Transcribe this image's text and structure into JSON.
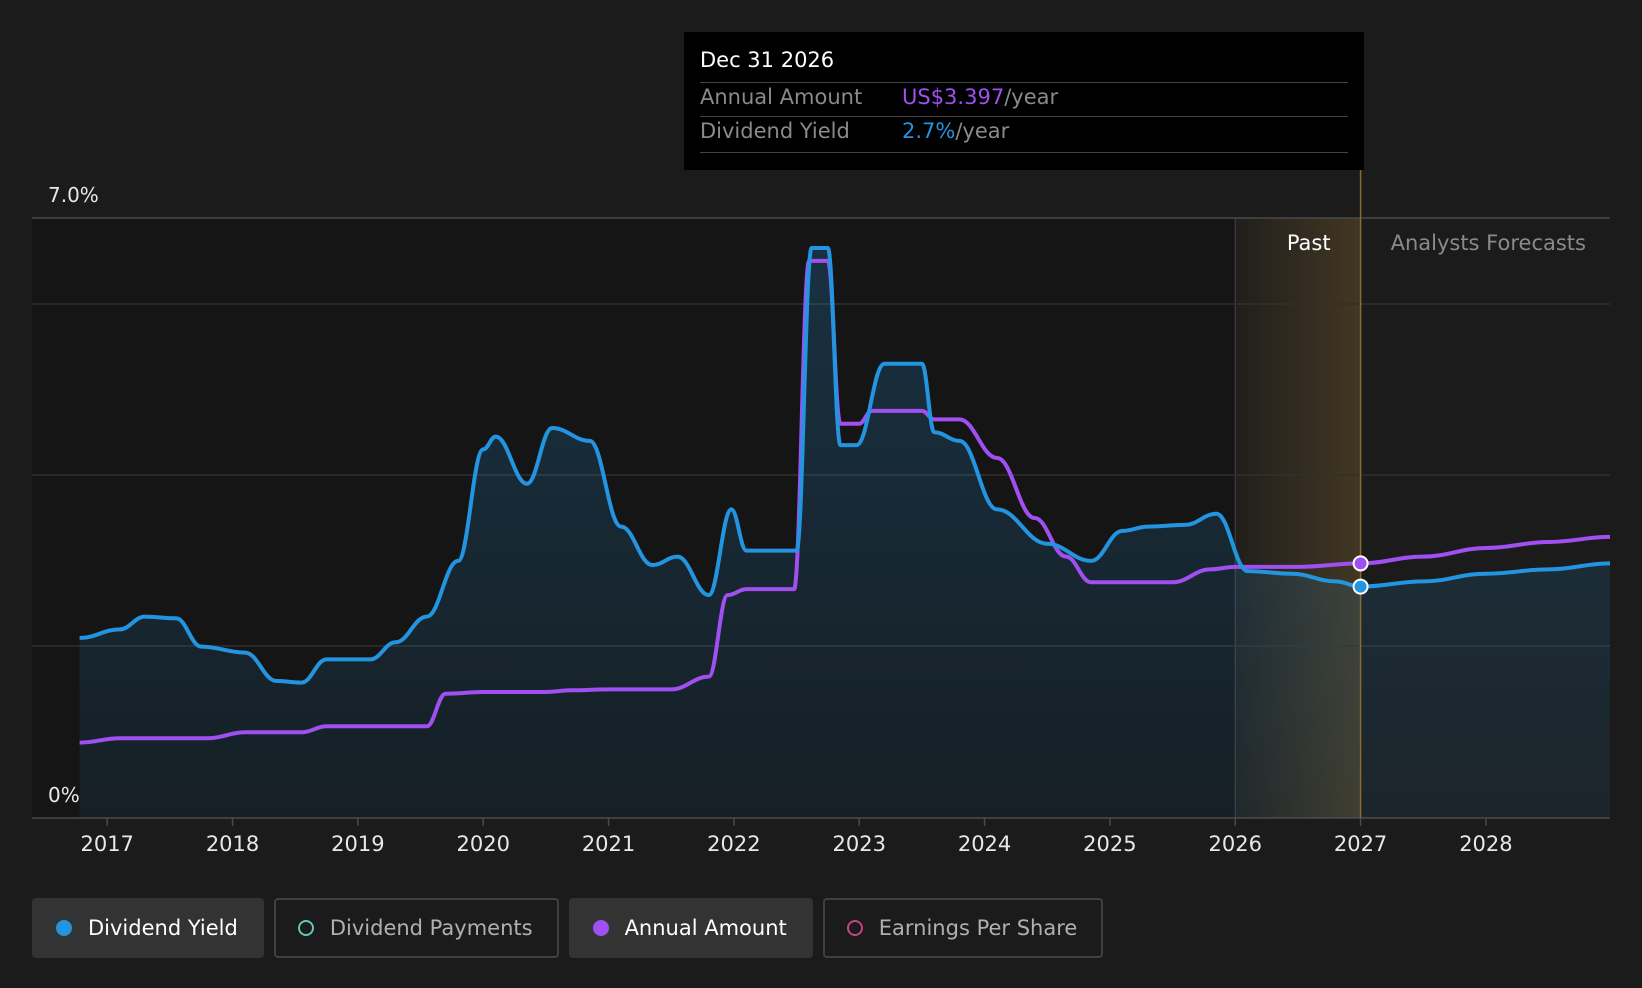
{
  "colors": {
    "background": "#1b1b1b",
    "plot_past": "#151515",
    "dividend_yield": "#2394df",
    "annual_amount": "#a04ff0",
    "dividend_payments": "#5fc9b9",
    "earnings_per_share": "#c9417f",
    "forecast_band": "#8a6a30",
    "grid": "#333333"
  },
  "tooltip": {
    "date": "Dec 31 2026",
    "rows": [
      {
        "label": "Annual Amount",
        "value": "US$3.397",
        "unit": "/year",
        "color": "#a04ff0"
      },
      {
        "label": "Dividend Yield",
        "value": "2.7%",
        "unit": "/year",
        "color": "#2394df"
      }
    ]
  },
  "legend": [
    {
      "label": "Dividend Yield",
      "color": "#2394df",
      "state": "active",
      "icon": "filled-dot-icon"
    },
    {
      "label": "Dividend Payments",
      "color": "#5fc9b9",
      "state": "inactive",
      "icon": "hollow-dot-icon"
    },
    {
      "label": "Annual Amount",
      "color": "#a04ff0",
      "state": "active",
      "icon": "filled-dot-icon"
    },
    {
      "label": "Earnings Per Share",
      "color": "#c9417f",
      "state": "inactive",
      "icon": "hollow-dot-icon"
    }
  ],
  "chart_data": {
    "type": "line",
    "title": "",
    "ylim": [
      0,
      7.0
    ],
    "y_tick_labels": [
      "0%",
      "7.0%"
    ],
    "x_tick_labels": [
      "2017",
      "2018",
      "2019",
      "2020",
      "2021",
      "2022",
      "2023",
      "2024",
      "2025",
      "2026",
      "2027",
      "2028"
    ],
    "x_range": [
      2016.4,
      2028.99
    ],
    "grid": true,
    "legend_placement": "bottom",
    "region_labels": {
      "past": "Past",
      "forecast": "Analysts Forecasts"
    },
    "forecast_start": 2026.0,
    "highlight_x": 2027.0,
    "series": [
      {
        "name": "Dividend Yield",
        "x": [
          2016.78,
          2017.1,
          2017.3,
          2017.55,
          2017.75,
          2018.1,
          2018.35,
          2018.55,
          2018.75,
          2019.1,
          2019.3,
          2019.55,
          2019.8,
          2020.0,
          2020.1,
          2020.35,
          2020.55,
          2020.85,
          2021.1,
          2021.35,
          2021.55,
          2021.8,
          2021.98,
          2022.1,
          2022.5,
          2022.62,
          2022.75,
          2022.85,
          2022.98,
          2023.2,
          2023.5,
          2023.6,
          2023.8,
          2024.1,
          2024.5,
          2024.85,
          2025.1,
          2025.3,
          2025.6,
          2025.85,
          2026.1,
          2026.45,
          2026.8,
          2027.0,
          2027.5,
          2028.0,
          2028.5,
          2028.99
        ],
        "values": [
          2.1,
          2.2,
          2.35,
          2.33,
          2.0,
          1.93,
          1.6,
          1.58,
          1.85,
          1.85,
          2.05,
          2.35,
          3.0,
          4.3,
          4.45,
          3.9,
          4.55,
          4.4,
          3.4,
          2.95,
          3.05,
          2.6,
          3.6,
          3.12,
          3.12,
          6.65,
          6.65,
          4.35,
          4.35,
          5.3,
          5.3,
          4.5,
          4.4,
          3.6,
          3.2,
          3.0,
          3.35,
          3.4,
          3.42,
          3.55,
          2.88,
          2.85,
          2.76,
          2.7,
          2.76,
          2.85,
          2.9,
          2.97
        ]
      },
      {
        "name": "Annual Amount",
        "x": [
          2016.78,
          2017.1,
          2017.5,
          2017.8,
          2018.1,
          2018.55,
          2018.75,
          2019.1,
          2019.55,
          2019.7,
          2020.0,
          2020.5,
          2020.7,
          2021.0,
          2021.5,
          2021.8,
          2021.95,
          2022.1,
          2022.48,
          2022.6,
          2022.75,
          2022.85,
          2023.0,
          2023.1,
          2023.5,
          2023.6,
          2023.8,
          2024.1,
          2024.4,
          2024.65,
          2024.85,
          2025.1,
          2025.5,
          2025.8,
          2026.0,
          2026.5,
          2027.0,
          2027.5,
          2028.0,
          2028.5,
          2028.99
        ],
        "values": [
          0.88,
          0.93,
          0.93,
          0.93,
          1.0,
          1.0,
          1.07,
          1.07,
          1.07,
          1.45,
          1.47,
          1.47,
          1.49,
          1.5,
          1.5,
          1.65,
          2.6,
          2.67,
          2.67,
          6.5,
          6.5,
          4.6,
          4.6,
          4.75,
          4.75,
          4.65,
          4.65,
          4.2,
          3.5,
          3.05,
          2.75,
          2.75,
          2.75,
          2.9,
          2.93,
          2.93,
          2.97,
          3.05,
          3.15,
          3.22,
          3.28
        ]
      }
    ]
  }
}
